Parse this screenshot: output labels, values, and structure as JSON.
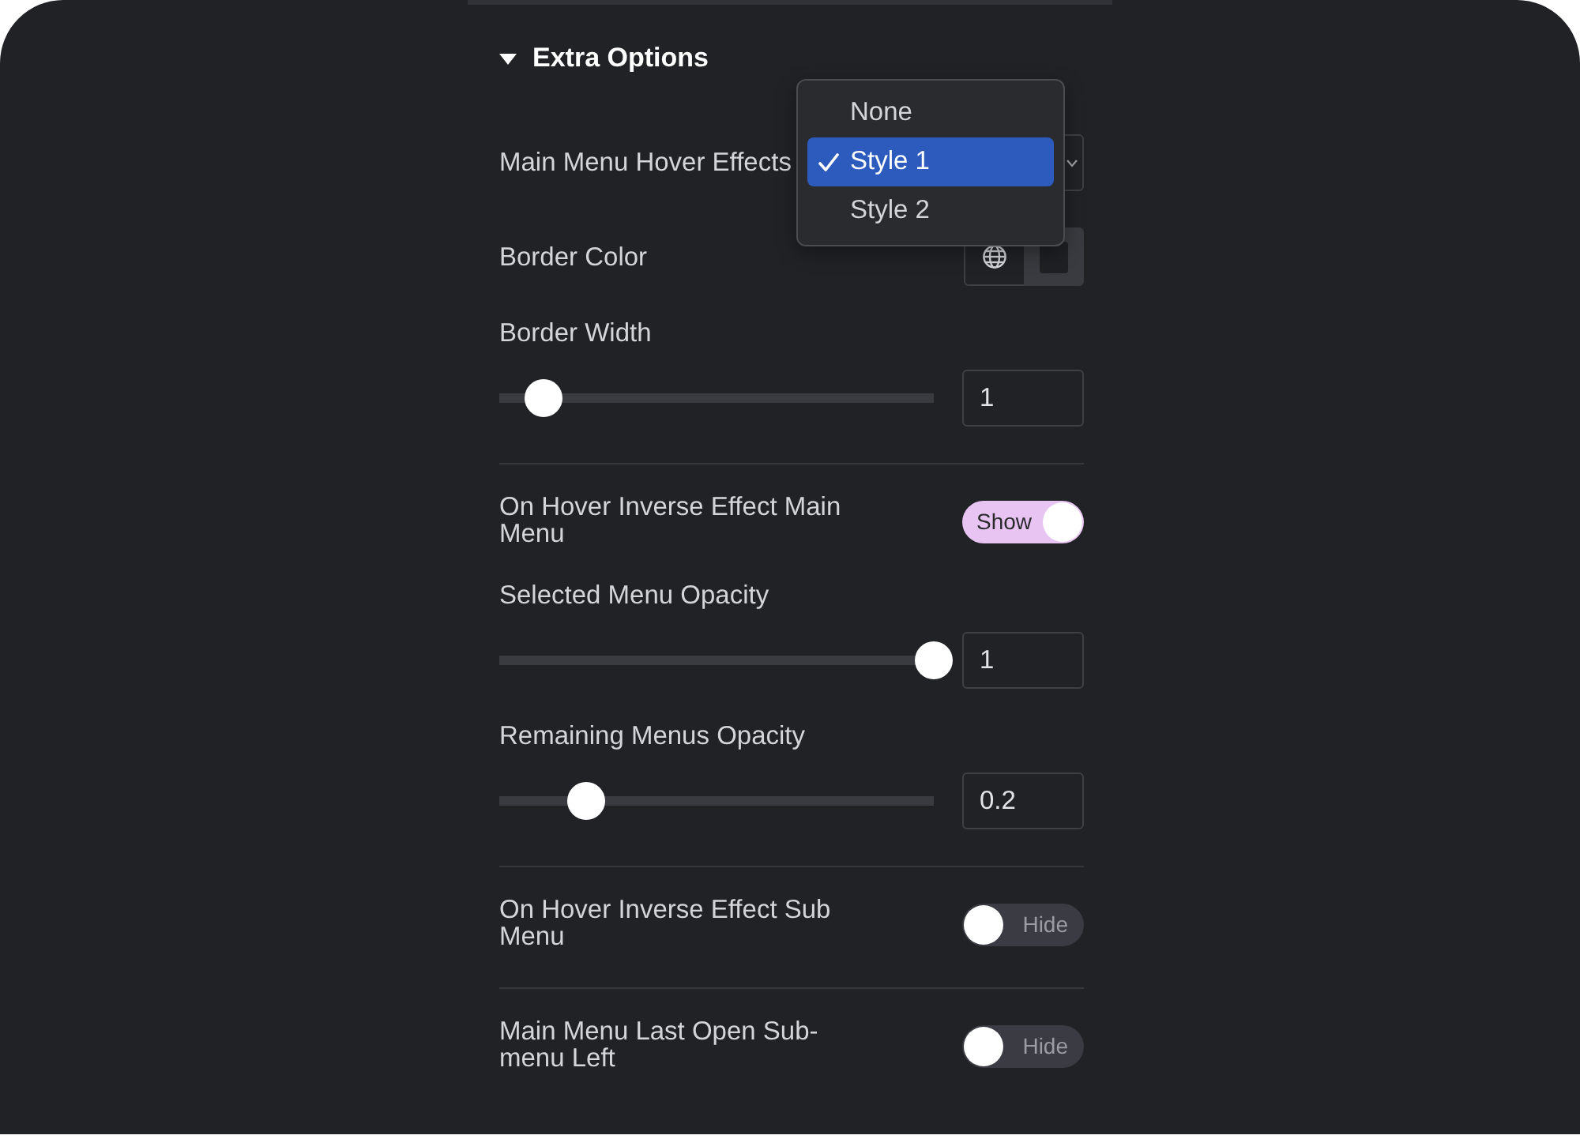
{
  "section": {
    "title": "Extra Options",
    "expanded": true
  },
  "groups": [
    {
      "controls": [
        {
          "kind": "select",
          "label": "Main Menu Hover Effects",
          "open": true,
          "options": [
            {
              "label": "None",
              "selected": false
            },
            {
              "label": "Style 1",
              "selected": true
            },
            {
              "label": "Style 2",
              "selected": false
            }
          ]
        },
        {
          "kind": "color",
          "label": "Border Color"
        },
        {
          "kind": "slider",
          "label": "Border Width",
          "level": 0.1,
          "value": "1"
        }
      ]
    },
    {
      "controls": [
        {
          "kind": "toggle",
          "label": "On Hover Inverse Effect Main Menu",
          "on": true,
          "state_text": "Show"
        },
        {
          "kind": "slider",
          "label": "Selected Menu Opacity",
          "level": 1,
          "value": "1"
        },
        {
          "kind": "slider",
          "label": "Remaining Menus Opacity",
          "level": 0.2,
          "value": "0.2"
        }
      ]
    },
    {
      "controls": [
        {
          "kind": "toggle",
          "label": "On Hover Inverse Effect Sub Menu",
          "on": false,
          "state_text": "Hide"
        }
      ]
    },
    {
      "controls": [
        {
          "kind": "toggle",
          "label": "Main Menu Last Open Sub-menu Left",
          "on": false,
          "state_text": "Hide"
        }
      ]
    }
  ]
}
